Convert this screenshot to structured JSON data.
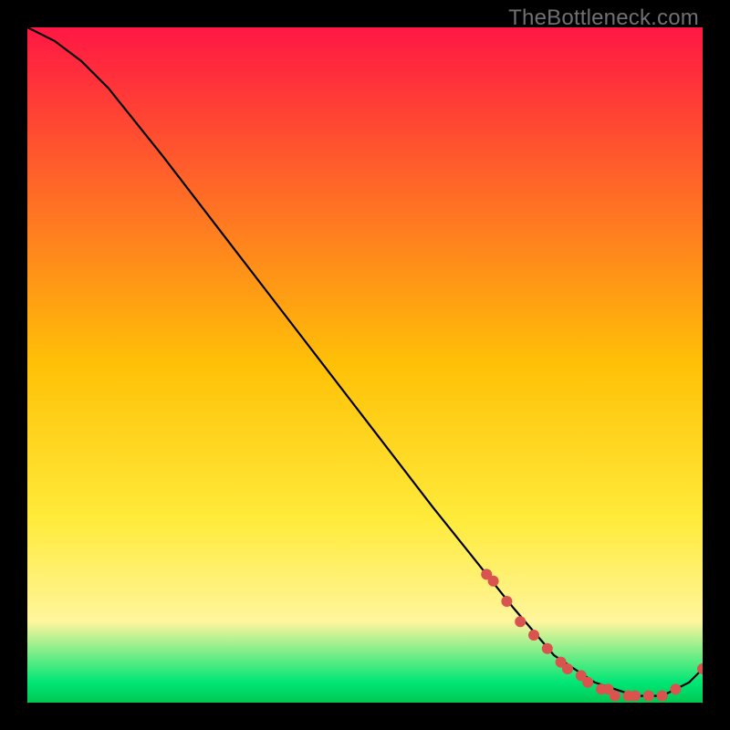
{
  "watermark": "TheBottleneck.com",
  "chart_data": {
    "type": "line",
    "title": "",
    "xlabel": "",
    "ylabel": "",
    "xlim": [
      0,
      100
    ],
    "ylim": [
      0,
      100
    ],
    "grid": false,
    "legend": false,
    "background_gradient": {
      "stops": [
        {
          "offset": 0.0,
          "color": "#ff1744"
        },
        {
          "offset": 0.5,
          "color": "#ffc107"
        },
        {
          "offset": 0.73,
          "color": "#ffeb3b"
        },
        {
          "offset": 0.88,
          "color": "#fff59d"
        },
        {
          "offset": 0.97,
          "color": "#00e676"
        },
        {
          "offset": 1.0,
          "color": "#00c853"
        }
      ]
    },
    "series": [
      {
        "name": "bottleneck-curve",
        "type": "line",
        "color": "#000000",
        "x": [
          0,
          4,
          8,
          12,
          20,
          30,
          40,
          50,
          60,
          68,
          72,
          78,
          84,
          90,
          94,
          98,
          100
        ],
        "y": [
          100,
          98,
          95,
          91,
          81,
          68,
          55,
          42,
          29,
          19,
          14,
          7,
          3,
          1,
          1,
          3,
          5
        ]
      },
      {
        "name": "gpu-markers",
        "type": "scatter",
        "color": "#d9534f",
        "x": [
          68,
          69,
          71,
          73,
          75,
          77,
          79,
          80,
          82,
          83,
          85,
          86,
          87,
          89,
          90,
          92,
          94,
          96,
          100
        ],
        "y": [
          19,
          18,
          15,
          12,
          10,
          8,
          6,
          5,
          4,
          3,
          2,
          2,
          1,
          1,
          1,
          1,
          1,
          2,
          5
        ]
      }
    ]
  }
}
